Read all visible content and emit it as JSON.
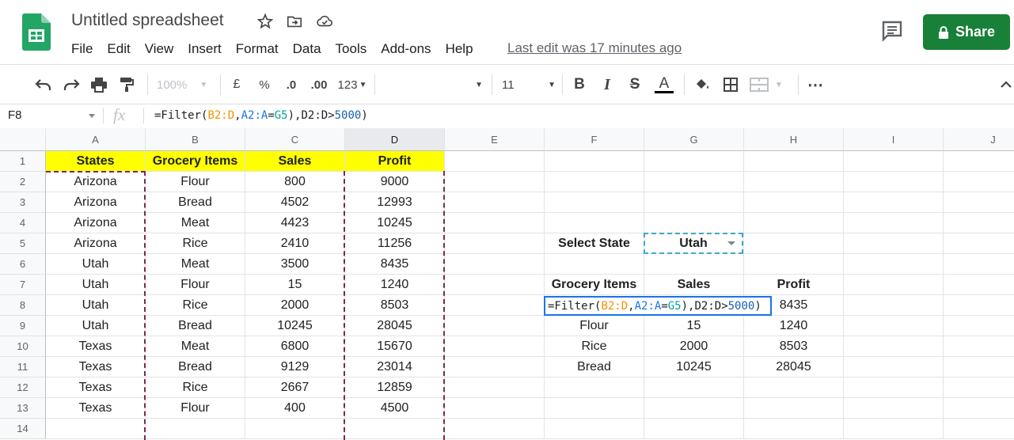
{
  "app": {
    "title": "Untitled spreadsheet",
    "last_edit": "Last edit was 17 minutes ago",
    "share_label": "Share",
    "menu": [
      "File",
      "Edit",
      "View",
      "Insert",
      "Format",
      "Data",
      "Tools",
      "Add-ons",
      "Help"
    ]
  },
  "toolbar": {
    "zoom": "100%",
    "currency": "£",
    "percent": "%",
    "dec_decrease": ".0",
    "dec_increase": ".00",
    "number_format": "123",
    "font_size": "11",
    "bold": "B",
    "italic": "I",
    "strike": "S",
    "text_color": "A",
    "more": "⋯"
  },
  "formula_bar": {
    "name_box": "F8",
    "fx": "fx",
    "formula": "=Filter(B2:D,A2:A=G5),D2:D>5000)"
  },
  "columns": [
    "A",
    "B",
    "C",
    "D",
    "E",
    "F",
    "G",
    "H",
    "I",
    "J"
  ],
  "rows": [
    "1",
    "2",
    "3",
    "4",
    "5",
    "6",
    "7",
    "8",
    "9",
    "10",
    "11",
    "12",
    "13",
    "14"
  ],
  "table": {
    "headers": [
      "States",
      "Grocery Items",
      "Sales",
      "Profit"
    ],
    "rows": [
      [
        "Arizona",
        "Flour",
        "800",
        "9000"
      ],
      [
        "Arizona",
        "Bread",
        "4502",
        "12993"
      ],
      [
        "Arizona",
        "Meat",
        "4423",
        "10245"
      ],
      [
        "Arizona",
        "Rice",
        "2410",
        "11256"
      ],
      [
        "Utah",
        "Meat",
        "3500",
        "8435"
      ],
      [
        "Utah",
        "Flour",
        "15",
        "1240"
      ],
      [
        "Utah",
        "Rice",
        "2000",
        "8503"
      ],
      [
        "Utah",
        "Bread",
        "10245",
        "28045"
      ],
      [
        "Texas",
        "Meat",
        "6800",
        "15670"
      ],
      [
        "Texas",
        "Bread",
        "9129",
        "23014"
      ],
      [
        "Texas",
        "Rice",
        "2667",
        "12859"
      ],
      [
        "Texas",
        "Flour",
        "400",
        "4500"
      ]
    ]
  },
  "selector": {
    "label": "Select State",
    "value": "Utah"
  },
  "result": {
    "headers": [
      "Grocery Items",
      "Sales",
      "Profit"
    ],
    "formula_parts": [
      "=Filter(",
      "B2:D",
      ",",
      "A2:A",
      "=",
      "G5",
      "),",
      "D2:D",
      ">",
      "5000",
      ")"
    ],
    "first_row_profit": "8435",
    "rows": [
      [
        "Flour",
        "15",
        "1240"
      ],
      [
        "Rice",
        "2000",
        "8503"
      ],
      [
        "Bread",
        "10245",
        "28045"
      ]
    ]
  },
  "colors": {
    "header_fill": "#ffff00",
    "share_green": "#188038",
    "selection_blue": "#1a73e8",
    "dash_border": "#7b2950"
  }
}
